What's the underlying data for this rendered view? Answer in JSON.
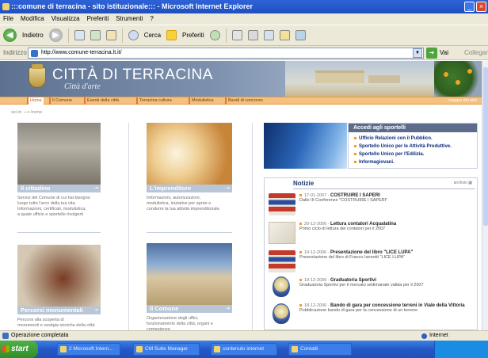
{
  "window": {
    "title": ":::comune di terracina - sito istituzionale::: - Microsoft Internet Explorer",
    "min": "_",
    "close": "×"
  },
  "menu": [
    "File",
    "Modifica",
    "Visualizza",
    "Preferiti",
    "Strumenti",
    "?"
  ],
  "toolbar": {
    "back_label": "Indietro",
    "search_label": "Cerca",
    "favorites_label": "Preferiti"
  },
  "address": {
    "label": "Indirizzo",
    "url": "http://www.comune-terracina.lt.it/",
    "go_label": "Vai",
    "links_label": "Collegamenti"
  },
  "site": {
    "title": "CITTÀ DI TERRACINA",
    "subtitle": "Città d'arte",
    "nav": [
      "Home",
      "Il Comune",
      "Eventi della città",
      "Terracina cultura",
      "Modulistica",
      "Bandi di concorso"
    ],
    "nav_right": "mappa del sito",
    "breadcrumb": "sei in:  ⟶  home"
  },
  "cards": [
    {
      "label": "Il cittadino",
      "text": [
        "Servizi del Comune di cui hai bisogno",
        "lungo tutto l'arco della tua vita.",
        "Informazioni, certificati, modulistica,",
        "a quale ufficio e sportello rivolgerti"
      ]
    },
    {
      "label": "L'imprenditore",
      "text": [
        "Informazioni, autorizzazioni,",
        "modulistica, iniziative per aprire e",
        "condurre la tua attività imprenditoriale."
      ]
    },
    {
      "label": "Percorsi monumentali",
      "text": [
        "Percorsi alla scoperta di",
        "monumenti e vestigia storiche della città"
      ]
    },
    {
      "label": "Il Comune",
      "text": [
        "Organizzazione degli uffici,",
        "funzionamento della città, organi e",
        "competenze"
      ]
    }
  ],
  "sportelli": {
    "title": "Accedi agli sportelli",
    "items": [
      "Ufficio Relazioni con il Pubblico.",
      "Sportello Unico per le Attività Produttive.",
      "Sportello Unico per l'Edilizia.",
      "Informagiovani."
    ]
  },
  "news": {
    "title": "Notizie",
    "archive_label": "archivio",
    "items": [
      {
        "date": "17-01-2007",
        "title": "COSTRUIRE I SAPERI",
        "desc": "Dalle III Conferenze \"COSTRUIRE I SAPERI\""
      },
      {
        "date": "20-12-2006",
        "title": "Lettura contatori Acqualatina",
        "desc": "Primo ciclo di lettura dei contatori per il 2007"
      },
      {
        "date": "19-12-2006",
        "title": "Presentazione del libro \"LICE LUPA\"",
        "desc": "Presentazione del libro di Franco Iannotti \"LICE LUPA\""
      },
      {
        "date": "19-12-2006",
        "title": "Graduatoria Sportivi",
        "desc": "Graduatoria Sportivi per il mercato settimanale valida per il 2007"
      },
      {
        "date": "18-12-2006",
        "title": "Bando di gara per concessione terreni in Viale della Vittoria",
        "desc": "Pubblicazione bando di gara per la concessione di un terreno"
      }
    ]
  },
  "status": {
    "text": "Operazione completata",
    "zone": "Internet"
  },
  "taskbar": {
    "start": "start",
    "tasks": [
      "2 Microsoft Intern...",
      "CM Suite Manager",
      "contenuto internet",
      "Contatti"
    ]
  }
}
